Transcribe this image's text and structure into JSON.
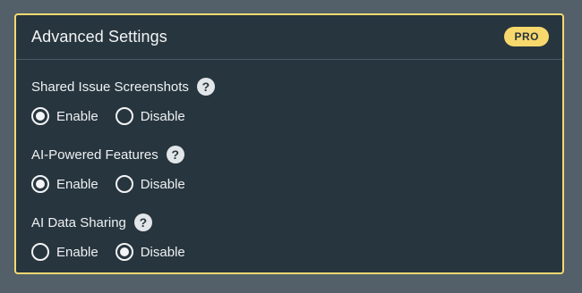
{
  "panel": {
    "title": "Advanced Settings",
    "badge": "PRO"
  },
  "settings": [
    {
      "label": "Shared Issue Screenshots",
      "help_icon": "question-circle-icon",
      "options": [
        {
          "label": "Enable",
          "checked": true
        },
        {
          "label": "Disable",
          "checked": false
        }
      ]
    },
    {
      "label": "AI-Powered Features",
      "help_icon": "question-circle-icon",
      "options": [
        {
          "label": "Enable",
          "checked": true
        },
        {
          "label": "Disable",
          "checked": false
        }
      ]
    },
    {
      "label": "AI Data Sharing",
      "help_icon": "question-circle-icon",
      "options": [
        {
          "label": "Enable",
          "checked": false
        },
        {
          "label": "Disable",
          "checked": true
        }
      ]
    }
  ],
  "colors": {
    "background": "#536069",
    "panel": "#27353e",
    "border_accent": "#f2da72",
    "badge": "#f7d86c"
  }
}
